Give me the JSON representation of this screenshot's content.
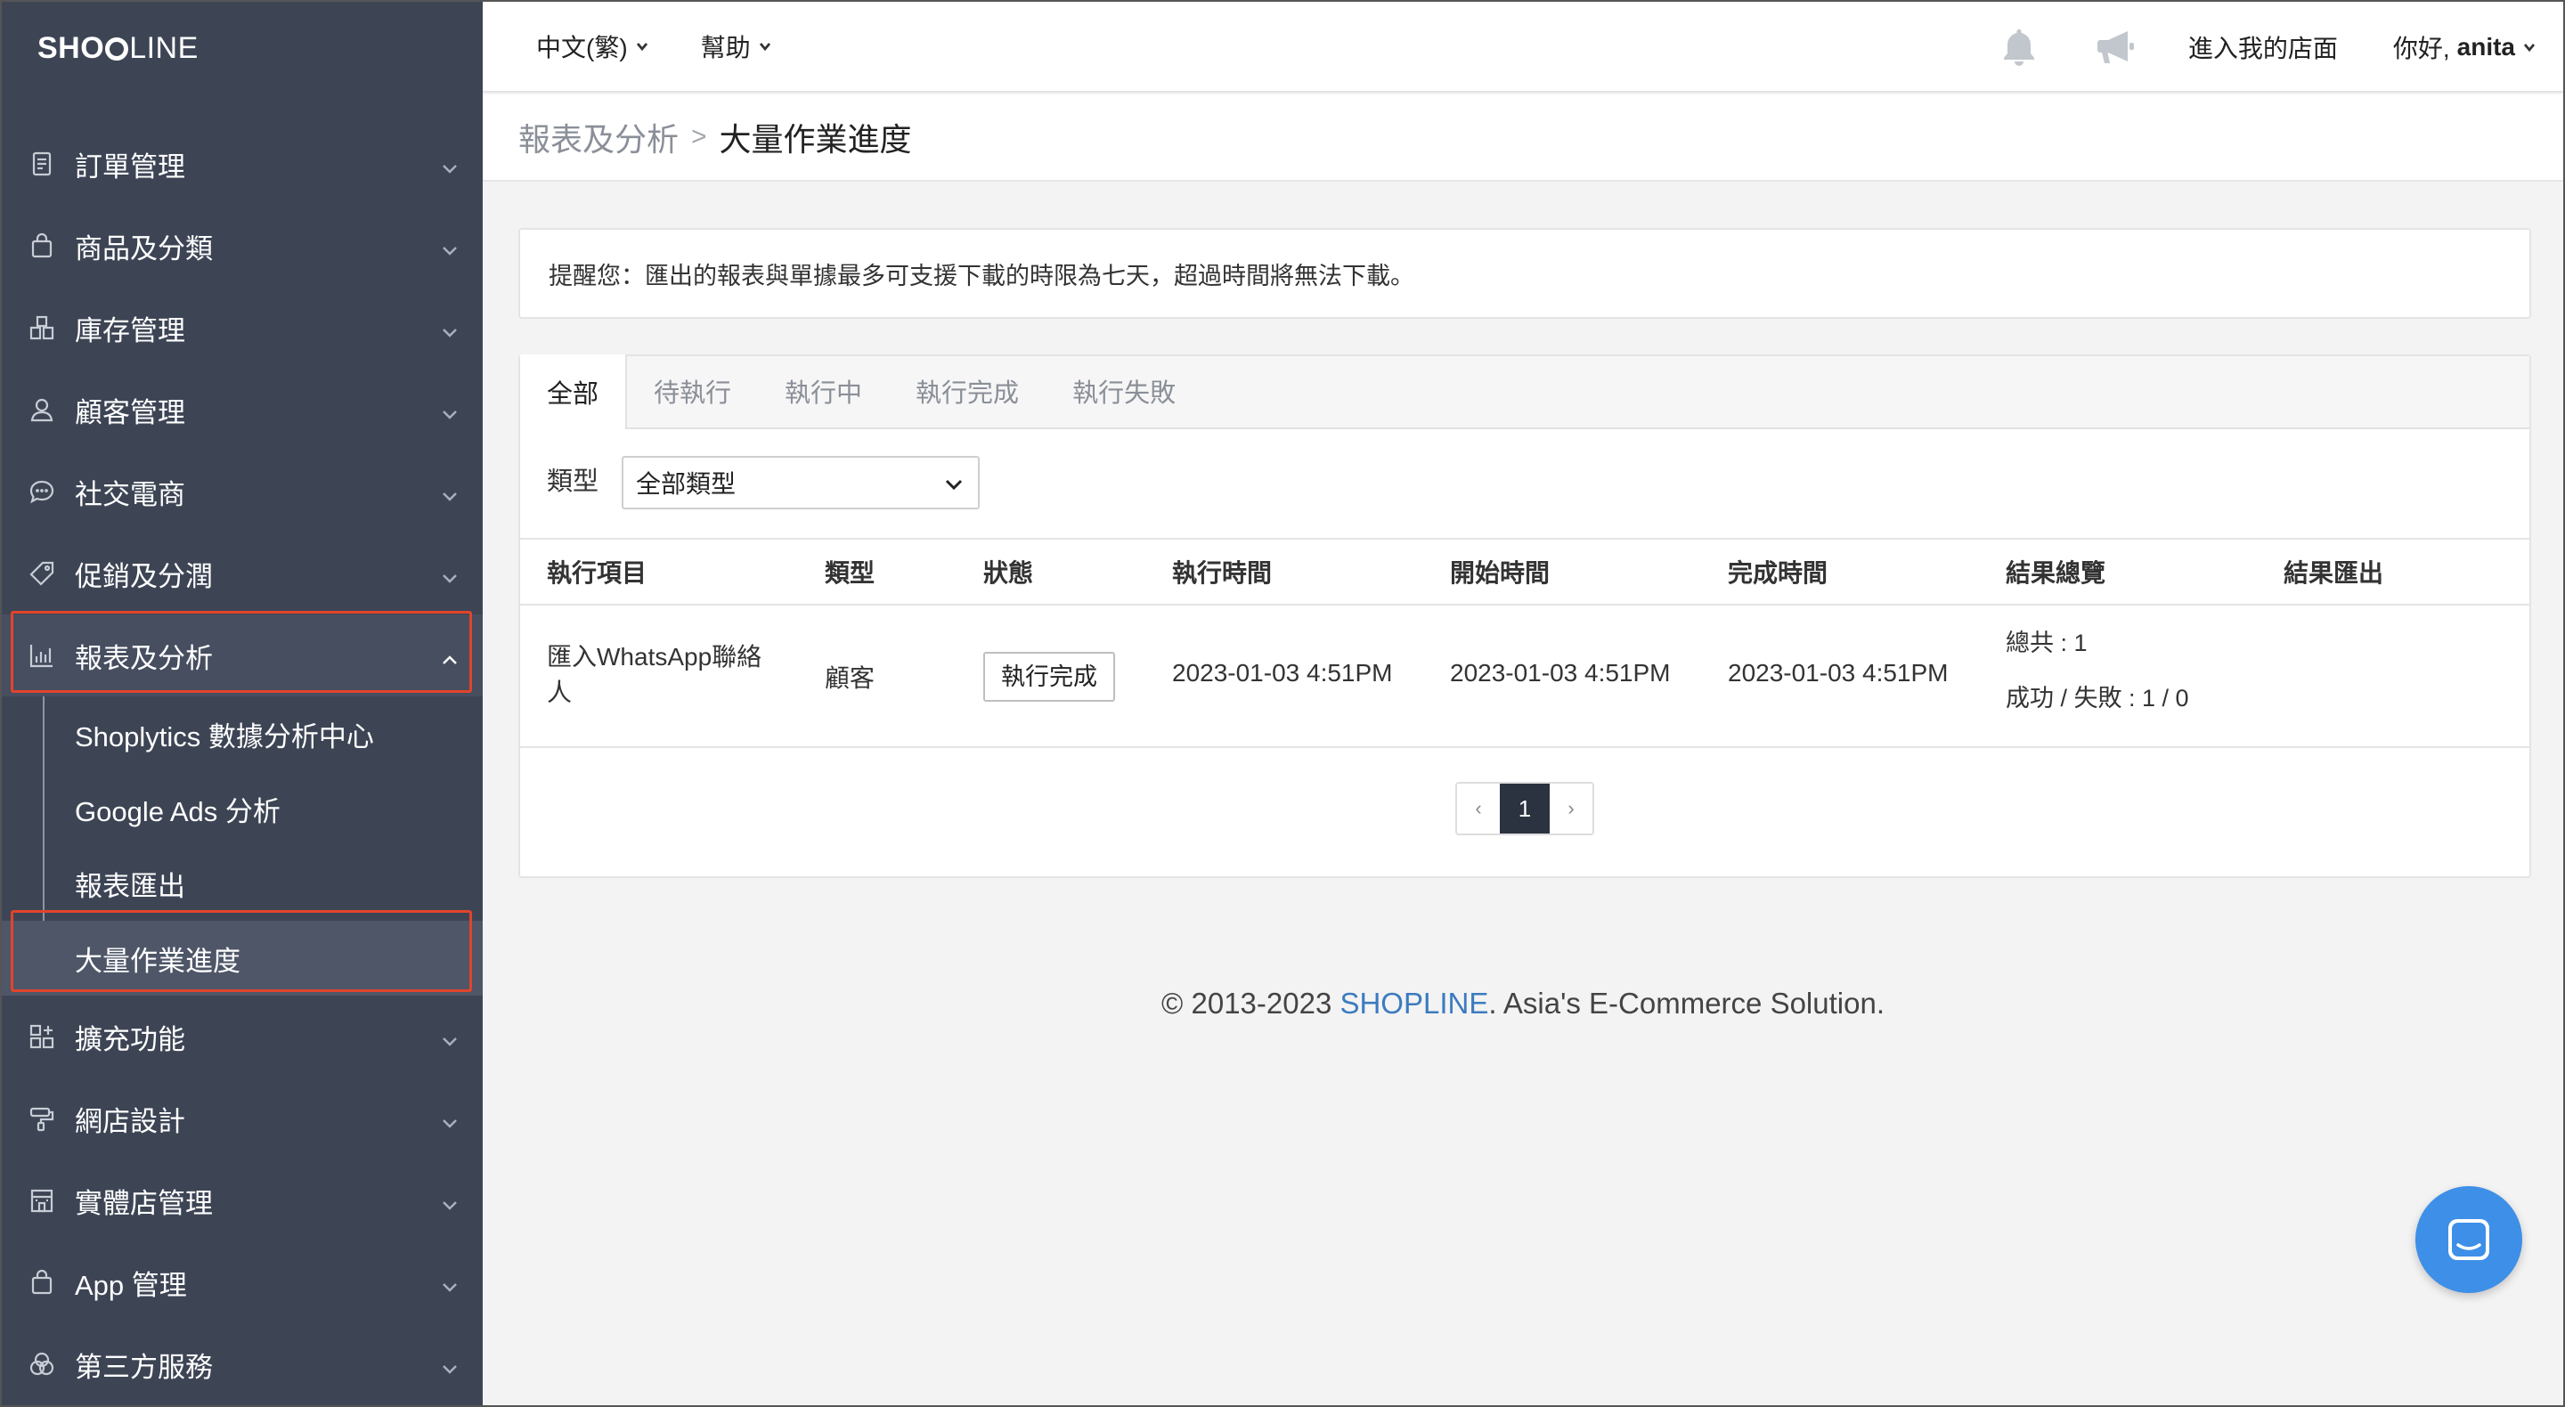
{
  "brand": {
    "logo_left": "SHO",
    "logo_right": "LINE"
  },
  "sidebar": {
    "items": [
      {
        "label": "訂單管理",
        "icon": "clipboard-icon"
      },
      {
        "label": "商品及分類",
        "icon": "shopping-bag-icon"
      },
      {
        "label": "庫存管理",
        "icon": "boxes-icon"
      },
      {
        "label": "顧客管理",
        "icon": "person-icon"
      },
      {
        "label": "社交電商",
        "icon": "chat-bubble-icon"
      },
      {
        "label": "促銷及分潤",
        "icon": "tag-icon"
      },
      {
        "label": "報表及分析",
        "icon": "bar-chart-icon"
      },
      {
        "label": "擴充功能",
        "icon": "grid-plus-icon"
      },
      {
        "label": "網店設計",
        "icon": "paint-roller-icon"
      },
      {
        "label": "實體店管理",
        "icon": "store-icon"
      },
      {
        "label": "App 管理",
        "icon": "shopping-bag-icon"
      },
      {
        "label": "第三方服務",
        "icon": "circles-icon"
      }
    ],
    "sub_items": [
      {
        "label": "Shoplytics 數據分析中心"
      },
      {
        "label": "Google Ads 分析"
      },
      {
        "label": "報表匯出"
      },
      {
        "label": "大量作業進度"
      }
    ]
  },
  "topbar": {
    "language": "中文(繁)",
    "help": "幫助",
    "store_link": "進入我的店面",
    "greeting": "你好,",
    "username": "anita"
  },
  "breadcrumb": {
    "parent": "報表及分析",
    "current": "大量作業進度"
  },
  "notice": "提醒您：匯出的報表與單據最多可支援下載的時限為七天，超過時間將無法下載。",
  "tabs": [
    {
      "label": "全部"
    },
    {
      "label": "待執行"
    },
    {
      "label": "執行中"
    },
    {
      "label": "執行完成"
    },
    {
      "label": "執行失敗"
    }
  ],
  "filter": {
    "label": "類型",
    "value": "全部類型"
  },
  "table": {
    "headers": [
      "執行項目",
      "類型",
      "狀態",
      "執行時間",
      "開始時間",
      "完成時間",
      "結果總覽",
      "結果匯出"
    ],
    "rows": [
      {
        "item": "匯入WhatsApp聯絡人",
        "type": "顧客",
        "status": "執行完成",
        "exec_time": "2023-01-03 4:51PM",
        "start_time": "2023-01-03 4:51PM",
        "end_time": "2023-01-03 4:51PM",
        "summary_total": "總共 : 1",
        "summary_result": "成功 / 失敗 : 1 / 0"
      }
    ]
  },
  "pagination": {
    "prev": "‹",
    "current": "1",
    "next": "›"
  },
  "footer": {
    "prefix": "© 2013-2023 ",
    "brand": "SHOPLINE",
    "suffix": ". Asia's E-Commerce Solution."
  },
  "colors": {
    "sidebar_bg": "#3d4555",
    "highlight_border": "#e2442c",
    "link": "#3b7bbf",
    "chat_button": "#3e8fe8"
  }
}
